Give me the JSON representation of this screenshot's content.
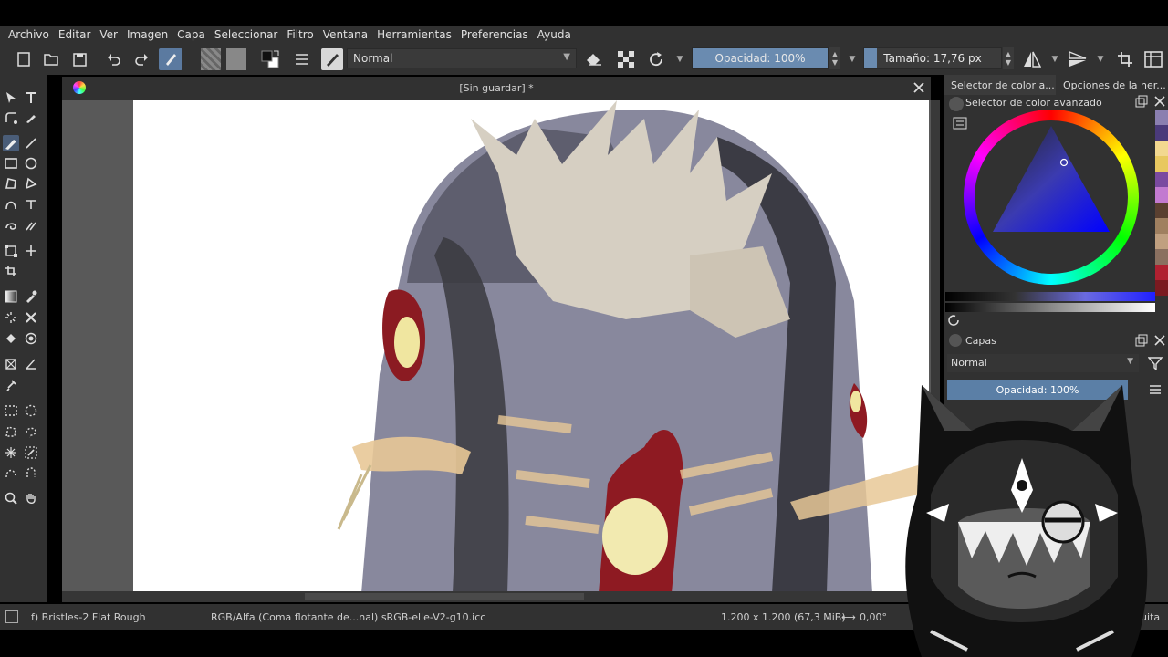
{
  "menu": [
    "Archivo",
    "Editar",
    "Ver",
    "Imagen",
    "Capa",
    "Seleccionar",
    "Filtro",
    "Ventana",
    "Herramientas",
    "Preferencias",
    "Ayuda"
  ],
  "toolbar": {
    "blend_mode": "Normal",
    "opacity_label": "Opacidad: 100%",
    "opacity_value": 1.0,
    "size_label": "Tamaño: 17,76 px",
    "size_value_fraction": 0.09
  },
  "document": {
    "tab_title": "[Sin guardar]  *"
  },
  "status": {
    "brush": "f) Bristles-2 Flat Rough",
    "color_space": "RGB/Alfa (Coma flotante de...nal)  sRGB-elle-V2-g10.icc",
    "dimensions": "1.200 x 1.200 (67,3 MiB)",
    "rotation": "0,00°"
  },
  "right_panel": {
    "tabs": [
      "Selector de color a...",
      "Opciones de la her..."
    ],
    "color_selector_title": "Selector de color avanzado",
    "layers_title": "Capas",
    "layers_blend": "Normal",
    "layers_opacity": "Opacidad:  100%",
    "label_partial": "iquita"
  },
  "colors": {
    "ui_bg": "#313131",
    "accent": "#6a8bb0",
    "canvas": "#ffffff"
  },
  "swatch_colors": [
    "#8a7fb0",
    "#4a3a7a",
    "#f2d890",
    "#e8c860",
    "#7a4aa0",
    "#c27ad0",
    "#5a4030",
    "#a08060",
    "#c0a080",
    "#8a7060",
    "#b02030",
    "#7a1a20"
  ]
}
